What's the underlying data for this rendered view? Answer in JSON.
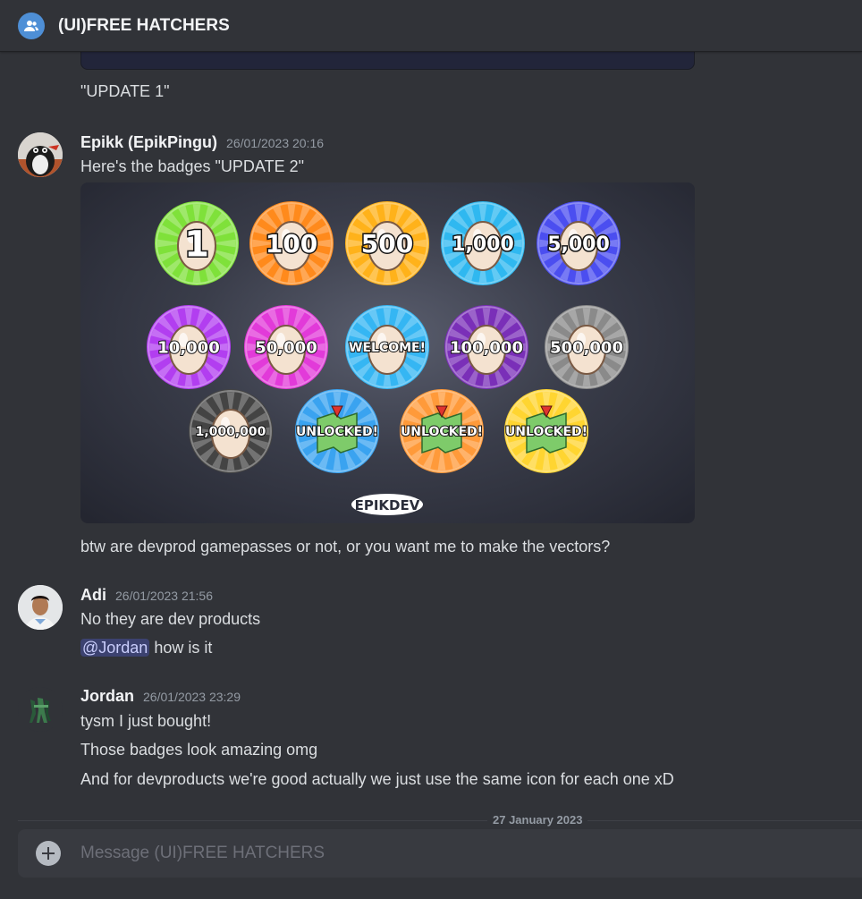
{
  "header": {
    "title": "(UI)FREE HATCHERS",
    "icon": "group-dm-icon"
  },
  "messages": {
    "prev_text": "\"UPDATE 1\"",
    "epikk": {
      "author": "Epikk (EpikPingu)",
      "timestamp": "26/01/2023 20:16",
      "lines": [
        "Here's the badges \"UPDATE 2\"",
        "btw are devprod gamepasses or not, or you want me to make the vectors?"
      ]
    },
    "adi": {
      "author": "Adi",
      "timestamp": "26/01/2023 21:56",
      "lines": [
        "No they are dev products"
      ],
      "mention": "@Jordan",
      "mention_suffix": " how is it"
    },
    "jordan": {
      "author": "Jordan",
      "timestamp": "26/01/2023 23:29",
      "lines": [
        "tysm I just bought!",
        "Those badges look amazing omg",
        "And for devproducts we're good actually we just use the same icon for each one xD"
      ]
    }
  },
  "badges": {
    "labels": [
      "1",
      "100",
      "500",
      "1,000",
      "5,000",
      "10,000",
      "50,000",
      "WELCOME!",
      "100,000",
      "500,000",
      "1,000,000",
      "UNLOCKED!",
      "UNLOCKED!",
      "UNLOCKED!"
    ],
    "colors": [
      "#7fe13a",
      "#ff8a1c",
      "#ffb21a",
      "#2fb8f0",
      "#4b4ef0",
      "#b23ef0",
      "#e23ad9",
      "#35b6f3",
      "#7a2fb8",
      "#8a8a8a",
      "#444444",
      "#3aa3f0",
      "#ff9a3a",
      "#ffd531"
    ],
    "logo": "EPIKDEV"
  },
  "divider": {
    "label": "27 January 2023"
  },
  "composer": {
    "placeholder": "Message (UI)FREE HATCHERS"
  }
}
